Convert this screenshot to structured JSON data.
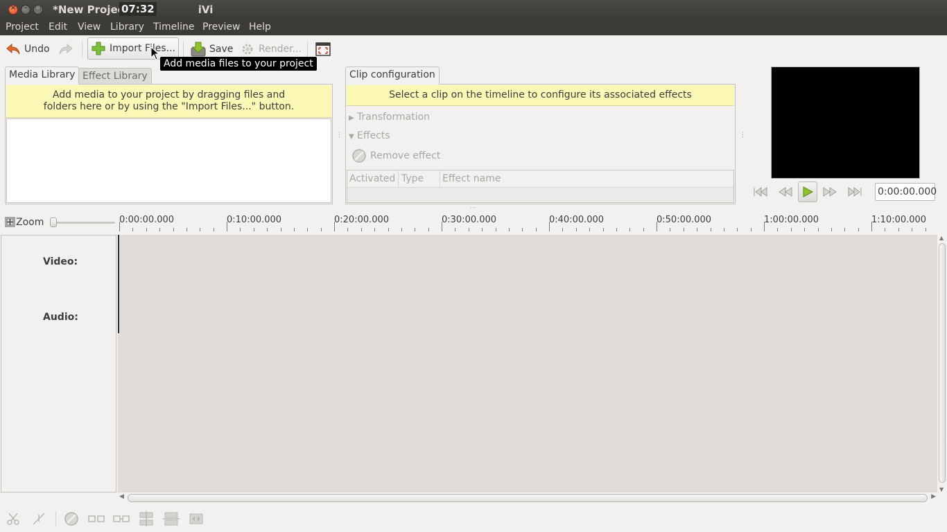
{
  "window": {
    "title_left": "*New Project",
    "title_right": "iVi",
    "clock": "07:32"
  },
  "menu": [
    "Project",
    "Edit",
    "View",
    "Library",
    "Timeline",
    "Preview",
    "Help"
  ],
  "toolbar": {
    "undo_label": "Undo",
    "import_label": "Import Files...",
    "save_label": "Save",
    "render_label": "Render...",
    "tooltip": "Add media files to your project"
  },
  "library": {
    "tabs": [
      "Media Library",
      "Effect Library"
    ],
    "hint": "Add media to your project by dragging files and folders here or by using the \"Import Files...\" button.",
    "hint_line1": "Add media to your project by dragging files and",
    "hint_line2": "folders here or by using the \"Import Files...\" button."
  },
  "clip_config": {
    "tab": "Clip configuration",
    "hint": "Select a clip on the timeline to configure its associated effects",
    "transformation": "Transformation",
    "effects": "Effects",
    "remove_effect": "Remove effect",
    "columns": [
      "Activated",
      "Type",
      "Effect name"
    ]
  },
  "viewer": {
    "time": "0:00:00.000"
  },
  "timeline": {
    "zoom_label": "Zoom",
    "ruler": [
      "0:00:00.000",
      "0:10:00.000",
      "0:20:00.000",
      "0:30:00.000",
      "0:40:00.000",
      "0:50:00.000",
      "1:00:00.000",
      "1:10:00.000"
    ],
    "tracks": [
      "Video:",
      "Audio:"
    ]
  },
  "colors": {
    "titlebar": "#3c3b37",
    "hint_yellow": "#fcf8b5",
    "timeline_bg": "#dedbd8",
    "play_green": "#8ec22d"
  }
}
